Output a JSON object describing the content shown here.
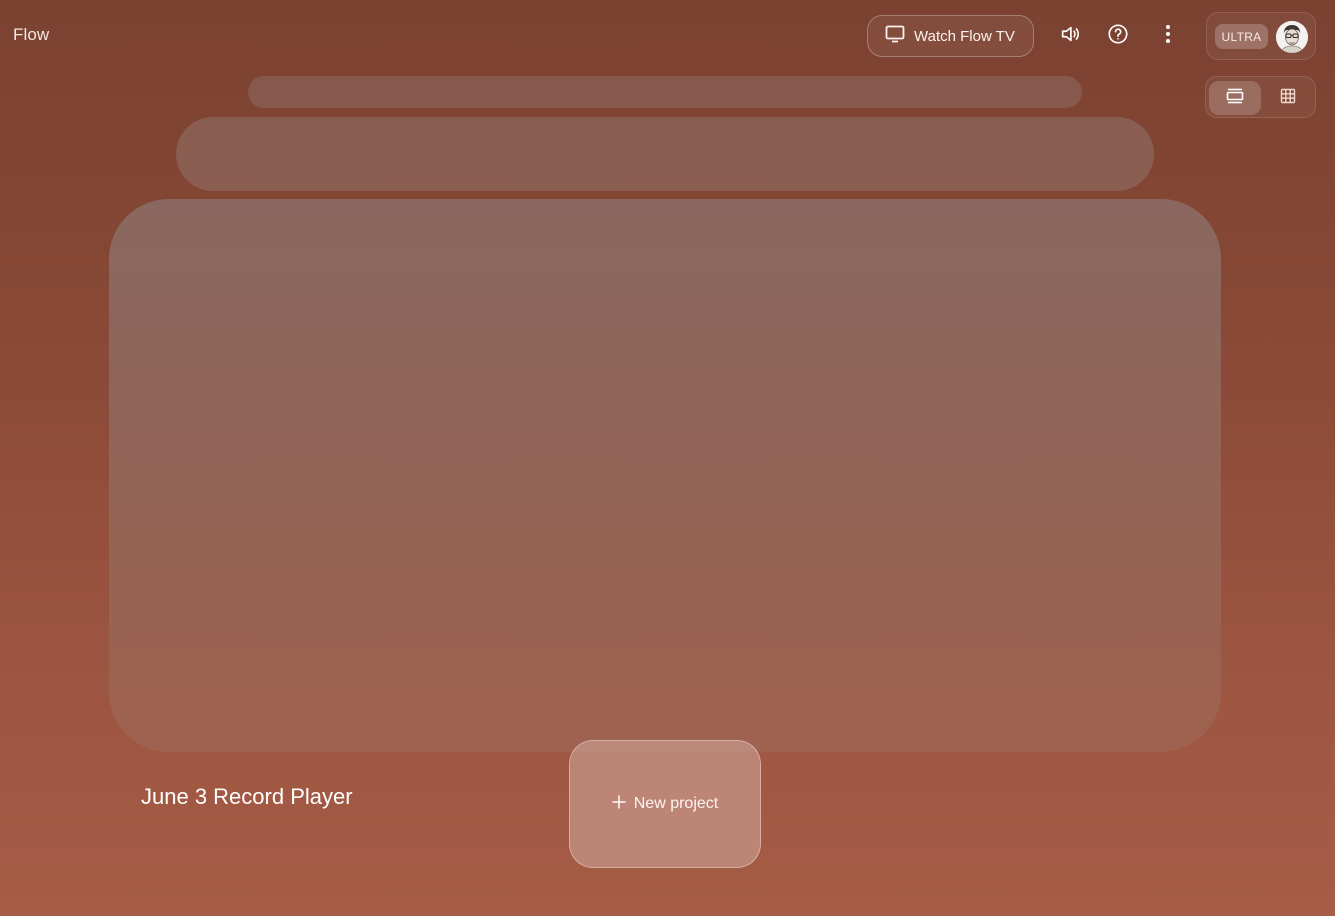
{
  "header": {
    "brand": "Flow",
    "watch_label": "Watch Flow TV",
    "plan_badge": "ULTRA"
  },
  "icons": {
    "tv": "tv-icon",
    "volume": "volume-icon",
    "help": "help-icon",
    "more": "more-vert-icon",
    "carousel_view": "carousel-view-icon",
    "grid_view": "grid-view-icon",
    "add": "plus-icon"
  },
  "view_toggle": {
    "selected": "carousel"
  },
  "project": {
    "title": "June 3 Record Player"
  },
  "new_project": {
    "label": "New project"
  },
  "colors": {
    "background_top": "#7b4131",
    "background_bottom": "#a65c45",
    "card": "#8c7670"
  }
}
